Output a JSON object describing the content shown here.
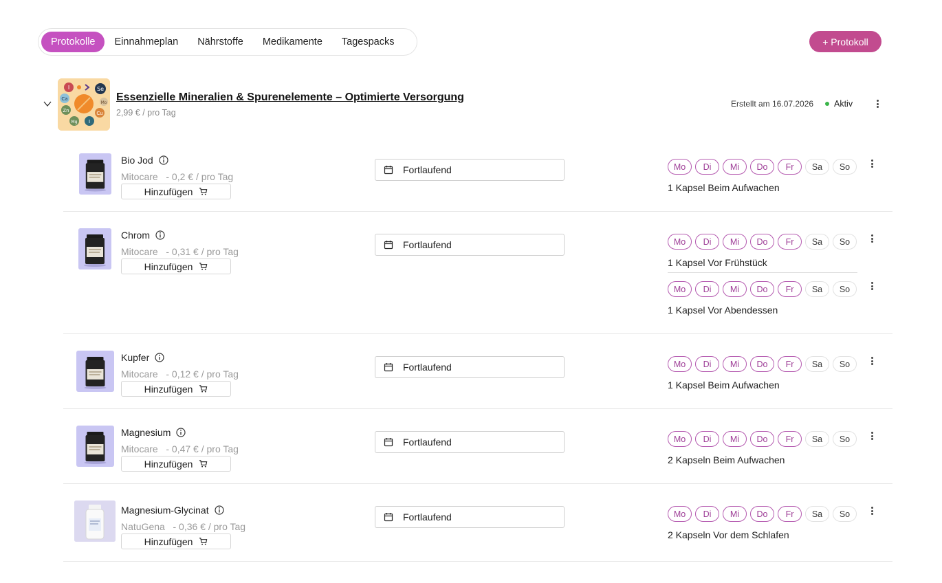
{
  "tabs": [
    {
      "label": "Protokolle",
      "active": true
    },
    {
      "label": "Einnahmeplan",
      "active": false
    },
    {
      "label": "Nährstoffe",
      "active": false
    },
    {
      "label": "Medikamente",
      "active": false
    },
    {
      "label": "Tagespacks",
      "active": false
    }
  ],
  "add_protocol_label": "+ Protokoll",
  "protocol": {
    "title": "Essenzielle Mineralien & Spurenelemente – Optimierte Versorgung",
    "price": "2,99 € / pro Tag",
    "created": "Erstellt am 16.07.2026",
    "status": "Aktiv",
    "image_letters": [
      "I",
      "Se",
      "Ca",
      "Mo",
      "Zn",
      "Cu",
      "Mg",
      "I"
    ]
  },
  "weekdays": [
    "Mo",
    "Di",
    "Mi",
    "Do",
    "Fr",
    "Sa",
    "So"
  ],
  "active_days": [
    true,
    true,
    true,
    true,
    true,
    false,
    false
  ],
  "add_button_label": "Hinzufügen",
  "duration_label": "Fortlaufend",
  "products": [
    {
      "name": "Bio Jod",
      "brand": "Mitocare",
      "price": "- 0,2 € / pro Tag",
      "image": "dark-jar",
      "schedules": [
        {
          "dose": "1 Kapsel Beim Aufwachen"
        }
      ]
    },
    {
      "name": "Chrom",
      "brand": "Mitocare",
      "price": "- 0,31 € / pro Tag",
      "image": "dark-jar",
      "schedules": [
        {
          "dose": "1 Kapsel Vor Frühstück"
        },
        {
          "dose": "1 Kapsel Vor Abendessen"
        }
      ]
    },
    {
      "name": "Kupfer",
      "brand": "Mitocare",
      "price": "- 0,12 € / pro Tag",
      "image": "dark-jar",
      "schedules": [
        {
          "dose": "1 Kapsel Beim Aufwachen"
        }
      ]
    },
    {
      "name": "Magnesium",
      "brand": "Mitocare",
      "price": "- 0,47 € / pro Tag",
      "image": "dark-jar",
      "schedules": [
        {
          "dose": "2 Kapseln Beim Aufwachen"
        }
      ]
    },
    {
      "name": "Magnesium-Glycinat",
      "brand": "NatuGena",
      "price": "- 0,36 € / pro Tag",
      "image": "white-bottle",
      "schedules": [
        {
          "dose": "2 Kapseln Vor dem Schlafen"
        }
      ]
    }
  ]
}
